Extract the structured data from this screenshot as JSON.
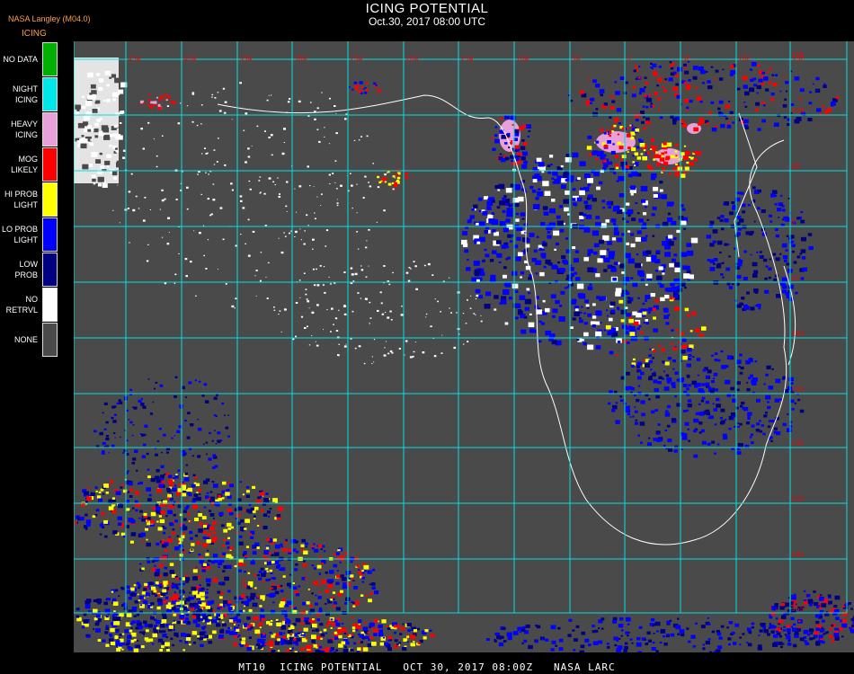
{
  "header": {
    "title": "ICING POTENTIAL",
    "subtitle": "Oct.30, 2017 08:00 UTC",
    "org": "NASA Langley (M04.0)",
    "product": "ICING"
  },
  "legend": [
    {
      "label": "NO DATA",
      "color": "#00b000"
    },
    {
      "label": "NIGHT\nICING",
      "color": "#00e8e8"
    },
    {
      "label": "HEAVY\nICING",
      "color": "#e8a0d8"
    },
    {
      "label": "MOG\nLIKELY",
      "color": "#ff0000"
    },
    {
      "label": "HI PROB\nLIGHT",
      "color": "#ffff00"
    },
    {
      "label": "LO PROB\nLIGHT",
      "color": "#0000ff"
    },
    {
      "label": "LOW\nPROB",
      "color": "#000080"
    },
    {
      "label": "NO\nRETRVL",
      "color": "#ffffff"
    },
    {
      "label": "NONE",
      "color": "#4a4a4a"
    }
  ],
  "colors": {
    "background": "#000000",
    "map_bg": "#4a4a4a",
    "grid": "#00e0e0",
    "coast": "#ffffff",
    "grid_label": "#d01010",
    "header_accent": "#ffa040"
  },
  "grid_labels": {
    "lon": [
      "45W",
      "40W",
      "35W",
      "30W",
      "25W",
      "20W",
      "15W",
      "10W",
      "5W",
      "0",
      "5E",
      "10E",
      "15E",
      "20E",
      "25E",
      "30E",
      "35E"
    ],
    "lat": [
      "15N",
      "10N",
      "5N",
      "0",
      "5S",
      "10S",
      "15S",
      "20S",
      "25S",
      "30S",
      "35S",
      "40S"
    ]
  },
  "footer": "MT10  ICING POTENTIAL   OCT 30, 2017 08:00Z   NASA LARC"
}
